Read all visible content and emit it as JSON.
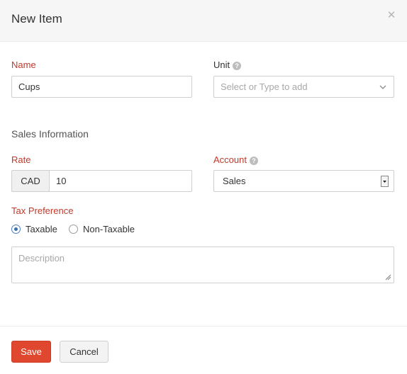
{
  "dialog": {
    "title": "New Item",
    "close_icon": "close-icon"
  },
  "form": {
    "name_label": "Name",
    "name_value": "Cups",
    "unit_label": "Unit",
    "unit_help_icon": "question-icon",
    "unit_placeholder": "Select or Type to add",
    "sales_section_title": "Sales Information",
    "rate_label": "Rate",
    "currency_code": "CAD",
    "rate_value": "10",
    "account_label": "Account",
    "account_help_icon": "question-icon",
    "account_selected": "Sales",
    "tax_label": "Tax Preference",
    "tax_options": [
      {
        "label": "Taxable",
        "checked": true
      },
      {
        "label": "Non-Taxable",
        "checked": false
      }
    ],
    "description_placeholder": "Description"
  },
  "footer": {
    "save_label": "Save",
    "cancel_label": "Cancel"
  },
  "colors": {
    "required_label": "#c0392b",
    "primary_button": "#e0472f",
    "radio_accent": "#3b6fb0"
  }
}
